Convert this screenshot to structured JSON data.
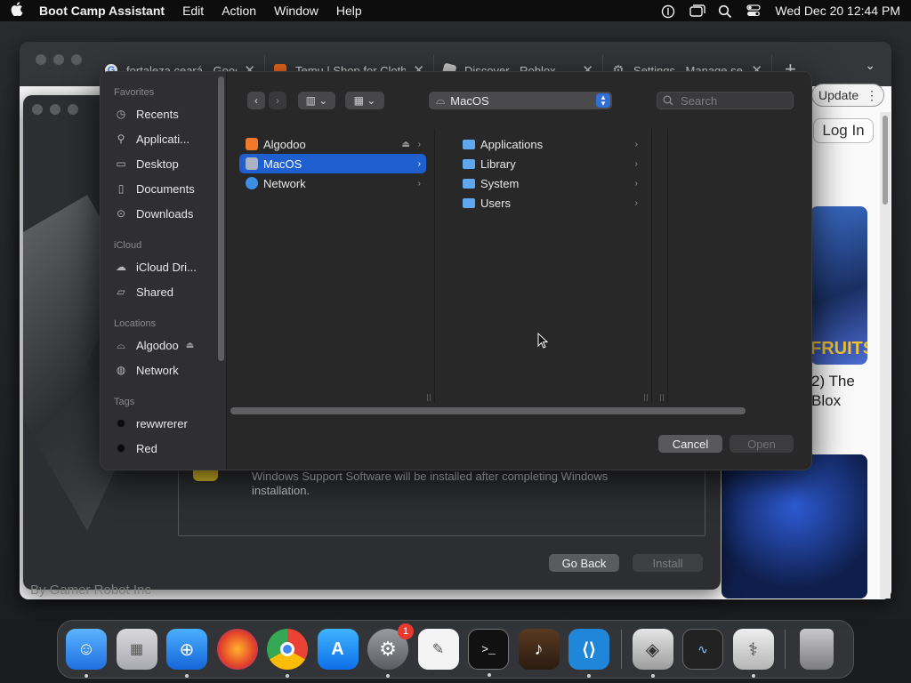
{
  "menubar": {
    "app_name": "Boot Camp Assistant",
    "menus": [
      "Edit",
      "Action",
      "Window",
      "Help"
    ],
    "datetime": "Wed Dec 20  12:44 PM"
  },
  "browser": {
    "tabs": [
      {
        "title": "fortaleza ceará - Goog",
        "favicon": "google-icon",
        "color": "#4285f4"
      },
      {
        "title": "Temu | Shop for Clothi",
        "favicon": "temu-icon",
        "color": "#f36b1c"
      },
      {
        "title": "Discover - Roblox",
        "favicon": "roblox-icon",
        "color": "#cfcfcf"
      },
      {
        "title": "Settings - Manage sea",
        "favicon": "gear-icon",
        "color": "#cfcfcf"
      }
    ],
    "update_label": "Update",
    "login_label": "Log In",
    "game_title_line1": "2) The",
    "game_title_line2": "Blox",
    "game_logo_text": "FRUITS",
    "footer_text": "By Gamer Robot Inc"
  },
  "bootcamp": {
    "note": "Windows Support Software will be installed after completing Windows installation.",
    "go_back_label": "Go Back",
    "install_label": "Install"
  },
  "dialog": {
    "sidebar": {
      "favorites_header": "Favorites",
      "favorites": [
        {
          "label": "Recents",
          "icon": "clock-icon"
        },
        {
          "label": "Applicati...",
          "icon": "applications-icon"
        },
        {
          "label": "Desktop",
          "icon": "desktop-icon"
        },
        {
          "label": "Documents",
          "icon": "document-icon"
        },
        {
          "label": "Downloads",
          "icon": "download-icon"
        }
      ],
      "icloud_header": "iCloud",
      "icloud": [
        {
          "label": "iCloud Dri...",
          "icon": "cloud-icon"
        },
        {
          "label": "Shared",
          "icon": "shared-folder-icon"
        }
      ],
      "locations_header": "Locations",
      "locations": [
        {
          "label": "Algodoo",
          "icon": "drive-icon"
        },
        {
          "label": "Network",
          "icon": "globe-icon"
        }
      ],
      "tags_header": "Tags",
      "tags": [
        {
          "label": "rewwrerer"
        },
        {
          "label": "Red"
        }
      ]
    },
    "path_label": "MacOS",
    "search_placeholder": "Search",
    "column1": [
      {
        "label": "Algodoo",
        "selected": false
      },
      {
        "label": "MacOS",
        "selected": true
      },
      {
        "label": "Network",
        "selected": false
      }
    ],
    "column2": [
      {
        "label": "Applications"
      },
      {
        "label": "Library"
      },
      {
        "label": "System"
      },
      {
        "label": "Users"
      }
    ],
    "cancel_label": "Cancel",
    "open_label": "Open"
  },
  "dock": {
    "settings_badge": "1"
  }
}
